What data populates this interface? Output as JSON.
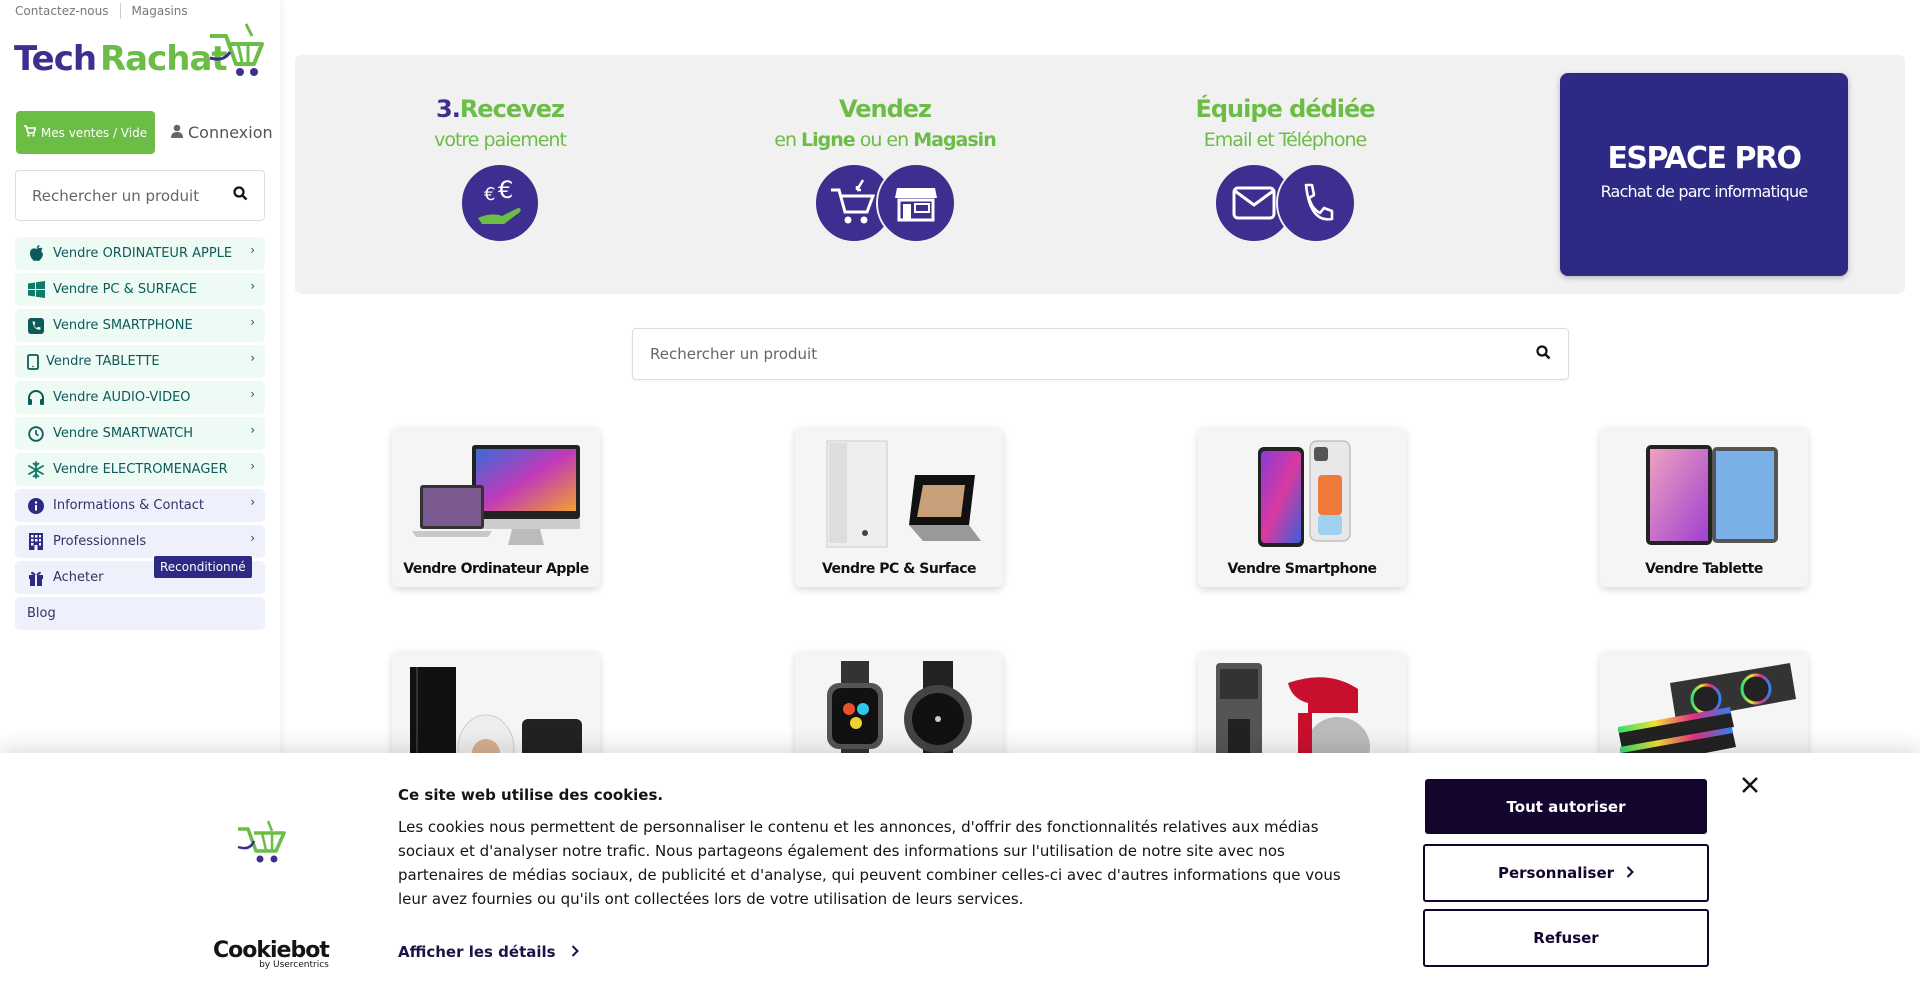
{
  "toplinks": {
    "contact": "Contactez-nous",
    "stores": "Magasins"
  },
  "logo": {
    "part1": "Tech",
    "part2": "Rachat"
  },
  "header": {
    "sales_button": "Mes ventes / Vide",
    "login": "Connexion"
  },
  "sidebar_search": {
    "placeholder": "Rechercher un produit"
  },
  "menu": [
    {
      "label": "Vendre ORDINATEUR APPLE",
      "icon": "apple-icon"
    },
    {
      "label": "Vendre PC & SURFACE",
      "icon": "windows-icon"
    },
    {
      "label": "Vendre SMARTPHONE",
      "icon": "phone-icon"
    },
    {
      "label": "Vendre TABLETTE",
      "icon": "tablet-icon"
    },
    {
      "label": "Vendre AUDIO-VIDEO",
      "icon": "headphones-icon"
    },
    {
      "label": "Vendre SMARTWATCH",
      "icon": "clock-icon"
    },
    {
      "label": "Vendre ELECTROMENAGER",
      "icon": "snowflake-icon"
    },
    {
      "label": "Informations & Contact",
      "icon": "info-icon"
    },
    {
      "label": "Professionnels",
      "icon": "building-icon"
    },
    {
      "label": "Acheter",
      "icon": "gift-icon"
    },
    {
      "label": "Blog",
      "icon": ""
    }
  ],
  "badge": "Reconditionné",
  "banner": {
    "feat1": {
      "num": "3.",
      "title": "Recevez",
      "sub": "votre paiement"
    },
    "feat2": {
      "title": "Vendez",
      "sub_a": "en ",
      "sub_b": "Ligne",
      "sub_c": " ou en ",
      "sub_d": "Magasin"
    },
    "feat3": {
      "title": "Équipe dédiée",
      "sub": "Email et Téléphone"
    },
    "pro": {
      "title": "ESPACE PRO",
      "sub": "Rachat de parc informatique"
    }
  },
  "main_search": {
    "placeholder": "Rechercher un produit"
  },
  "products": [
    "Vendre Ordinateur Apple",
    "Vendre PC & Surface",
    "Vendre Smartphone",
    "Vendre Tablette"
  ],
  "cookie": {
    "title": "Ce site web utilise des cookies.",
    "text": "Les cookies nous permettent de personnaliser le contenu et les annonces, d'offrir des fonctionnalités relatives aux médias sociaux et d'analyser notre trafic. Nous partageons également des informations sur l'utilisation de notre site avec nos partenaires de médias sociaux, de publicité et d'analyse, qui peuvent combiner celles-ci avec d'autres informations que vous leur avez fournies ou qu'ils ont collectées lors de votre utilisation de leurs services.",
    "details": "Afficher les détails",
    "allow_all": "Tout autoriser",
    "customize": "Personnaliser",
    "refuse": "Refuser",
    "brand": "Cookiebot",
    "brand_sub": "by Usercentrics"
  },
  "colors": {
    "green": "#6cbd45",
    "purple": "#3c2f8f",
    "navy": "#2d2a85",
    "cookie_dark": "#14052e"
  }
}
